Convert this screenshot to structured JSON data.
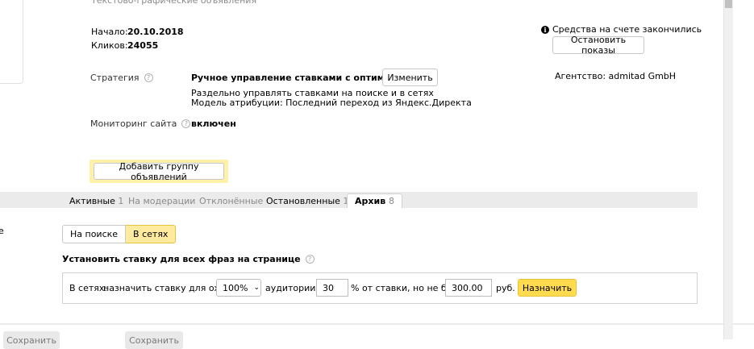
{
  "header": {
    "ad_type": "Текстово-графические объявления"
  },
  "campaign": {
    "start_label": "Начало:",
    "start_value": "20.10.2018",
    "clicks_label": "Кликов:",
    "clicks_value": "24055",
    "strategy_label": "Стратегия",
    "strategy_value": "Ручное управление ставками с оптимизацией",
    "strategy_change_label": "Изменить",
    "strategy_desc1": "Раздельно управлять ставками на поиске и в сетях",
    "strategy_desc2": "Модель атрибуции: Последний переход из Яндекс.Директа",
    "monitoring_label": "Мониторинг сайта",
    "monitoring_value": "включен",
    "add_group_label": "Добавить группу объявлений"
  },
  "account": {
    "funds_message": "Средства на счете закончились",
    "stop_label": "Остановить показы",
    "agency_text": "Агентство: admitad GmbH"
  },
  "tabs": [
    {
      "label": "Активные",
      "count": "1"
    },
    {
      "label": "На модерации",
      "count": ""
    },
    {
      "label": "Отклонённые",
      "count": ""
    },
    {
      "label": "Остановленные",
      "count": "1"
    },
    {
      "label": "Архив",
      "count": "8"
    }
  ],
  "active_tab": "Архив",
  "edge_text": "е",
  "placement": {
    "search_label": "На поиске",
    "networks_label": "В сетях",
    "selected": "В сетях"
  },
  "bid": {
    "heading": "Установить ставку для всех фраз на странице",
    "prefix": "В сетях:",
    "text1": "назначить ставку для охвата",
    "coverage_value": "100%",
    "text2": "аудитории +",
    "percent_value": "30",
    "text3": "% от ставки, но не более",
    "max_value": "300.00",
    "currency": "руб.",
    "apply_label": "Назначить"
  },
  "footer": {
    "left_button_label": "Сохранить",
    "right_button_label": "Сохранить"
  },
  "colors": {
    "accent_yellow": "#ffdb4d",
    "highlight_yellow": "#fff1a8",
    "tabs_bg": "#ebebeb"
  }
}
